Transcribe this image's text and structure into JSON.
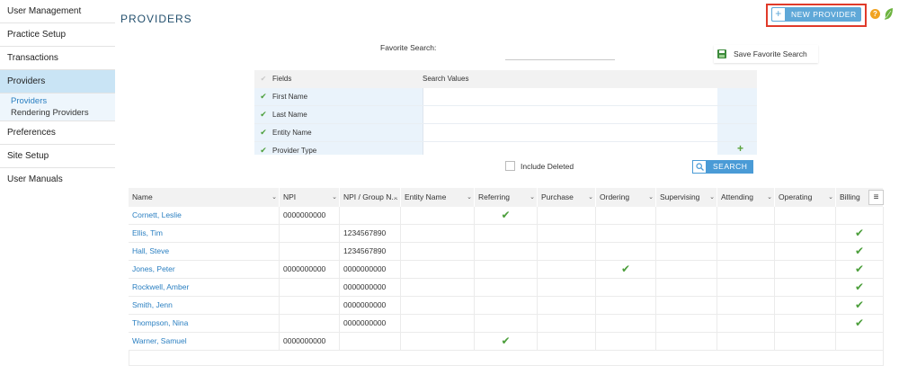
{
  "sidebar": {
    "items": [
      {
        "label": "User Management"
      },
      {
        "label": "Practice Setup"
      },
      {
        "label": "Transactions"
      },
      {
        "label": "Providers"
      },
      {
        "label": "Preferences"
      },
      {
        "label": "Site Setup"
      },
      {
        "label": "User Manuals"
      }
    ],
    "sub_items": [
      {
        "label": "Providers"
      },
      {
        "label": "Rendering Providers"
      }
    ]
  },
  "header": {
    "title": "PROVIDERS",
    "new_provider_label": "NEW PROVIDER",
    "help_glyph": "?"
  },
  "favorites": {
    "label": "Favorite Search:",
    "value": "",
    "save_label": "Save Favorite Search"
  },
  "filter": {
    "col_fields": "Fields",
    "col_values": "Search Values",
    "rows": [
      {
        "field": "First Name",
        "value": ""
      },
      {
        "field": "Last Name",
        "value": ""
      },
      {
        "field": "Entity Name",
        "value": ""
      },
      {
        "field": "Provider Type",
        "value": ""
      }
    ],
    "include_deleted_label": "Include Deleted",
    "search_label": "SEARCH"
  },
  "grid": {
    "columns": [
      "Name",
      "NPI",
      "NPI / Group N...",
      "Entity Name",
      "Referring",
      "Purchase",
      "Ordering",
      "Supervising",
      "Attending",
      "Operating",
      "Billing"
    ],
    "rows": [
      {
        "name": "Cornett, Leslie",
        "npi": "0000000000",
        "group_npi": "",
        "entity": "",
        "referring": true,
        "purchase": false,
        "ordering": false,
        "supervising": false,
        "attending": false,
        "operating": false,
        "billing": false
      },
      {
        "name": "Ellis, Tim",
        "npi": "",
        "group_npi": "1234567890",
        "entity": "",
        "referring": false,
        "purchase": false,
        "ordering": false,
        "supervising": false,
        "attending": false,
        "operating": false,
        "billing": true
      },
      {
        "name": "Hall, Steve",
        "npi": "",
        "group_npi": "1234567890",
        "entity": "",
        "referring": false,
        "purchase": false,
        "ordering": false,
        "supervising": false,
        "attending": false,
        "operating": false,
        "billing": true
      },
      {
        "name": "Jones, Peter",
        "npi": "0000000000",
        "group_npi": "0000000000",
        "entity": "",
        "referring": false,
        "purchase": false,
        "ordering": true,
        "supervising": false,
        "attending": false,
        "operating": false,
        "billing": true
      },
      {
        "name": "Rockwell, Amber",
        "npi": "",
        "group_npi": "0000000000",
        "entity": "",
        "referring": false,
        "purchase": false,
        "ordering": false,
        "supervising": false,
        "attending": false,
        "operating": false,
        "billing": true
      },
      {
        "name": "Smith, Jenn",
        "npi": "",
        "group_npi": "0000000000",
        "entity": "",
        "referring": false,
        "purchase": false,
        "ordering": false,
        "supervising": false,
        "attending": false,
        "operating": false,
        "billing": true
      },
      {
        "name": "Thompson, Nina",
        "npi": "",
        "group_npi": "0000000000",
        "entity": "",
        "referring": false,
        "purchase": false,
        "ordering": false,
        "supervising": false,
        "attending": false,
        "operating": false,
        "billing": true
      },
      {
        "name": "Warner, Samuel",
        "npi": "0000000000",
        "group_npi": "",
        "entity": "",
        "referring": true,
        "purchase": false,
        "ordering": false,
        "supervising": false,
        "attending": false,
        "operating": false,
        "billing": false
      }
    ]
  },
  "colors": {
    "accent": "#5fa8d8",
    "highlight_border": "#e03a2a",
    "check": "#4b9e3a",
    "link": "#2a7fc1",
    "active_nav": "#c9e4f5"
  }
}
